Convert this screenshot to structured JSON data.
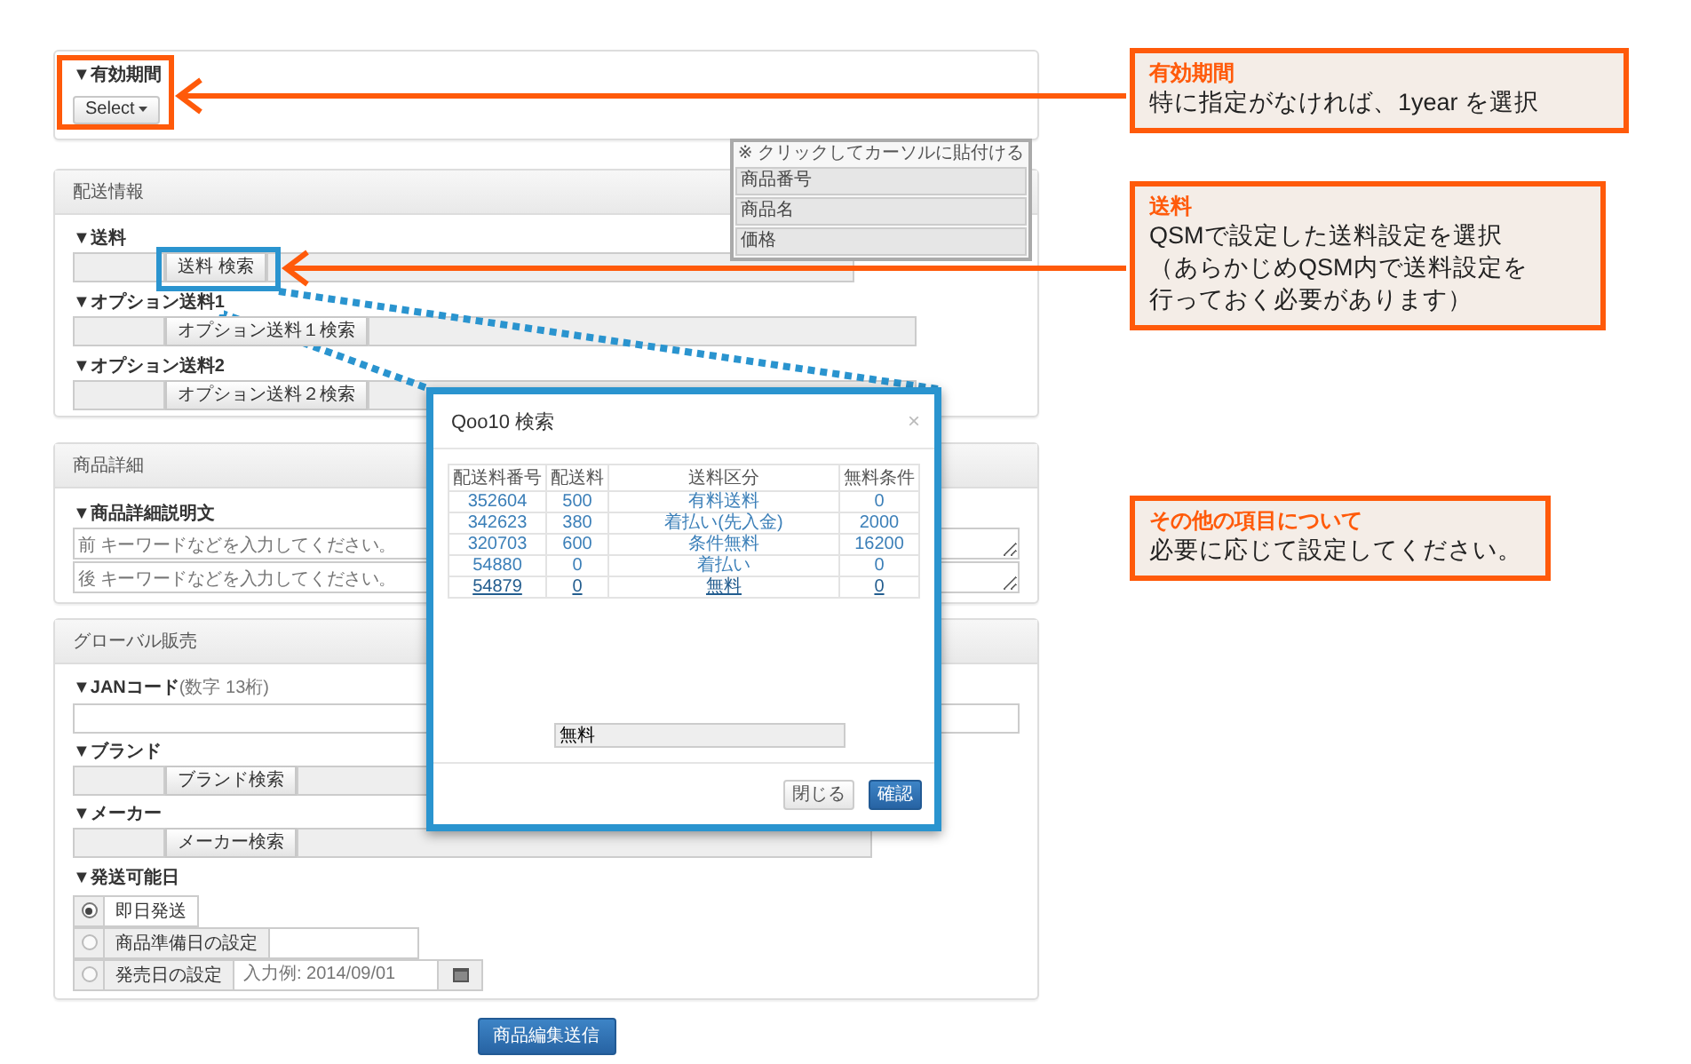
{
  "validity": {
    "label": "▼有効期間",
    "select_button": "Select"
  },
  "shipping": {
    "title": "配送情報",
    "fields": [
      {
        "label": "▼送料",
        "button": "送料 検索"
      },
      {
        "label": "▼オプション送料1",
        "button": "オプション送料１検索"
      },
      {
        "label": "▼オプション送料2",
        "button": "オプション送料２検索"
      }
    ]
  },
  "paste_palette": {
    "note": "※ クリックしてカーソルに貼付ける",
    "items": [
      "商品番号",
      "商品名",
      "価格"
    ]
  },
  "details": {
    "title": "商品詳細",
    "label": "▼商品詳細説明文",
    "textareas": [
      {
        "placeholder": "前 キーワードなどを入力してください。"
      },
      {
        "placeholder": "後 キーワードなどを入力してください。"
      }
    ]
  },
  "global_sales": {
    "title": "グローバル販売",
    "jan": {
      "label": "▼JANコード",
      "hint": "(数字 13桁)"
    },
    "lookups": [
      {
        "label": "▼ブランド",
        "button": "ブランド検索"
      },
      {
        "label": "▼メーカー",
        "button": "メーカー検索"
      }
    ],
    "ship_date": {
      "label": "▼発送可能日",
      "options": [
        {
          "kind": "plain",
          "label": "即日発送",
          "selected": true
        },
        {
          "kind": "input",
          "label": "商品準備日の設定",
          "selected": false
        },
        {
          "kind": "date",
          "label": "発売日の設定",
          "selected": false,
          "placeholder": "入力例: 2014/09/01"
        }
      ]
    }
  },
  "submit_button": "商品編集送信",
  "modal": {
    "title": "Qoo10 検索",
    "close": "×",
    "table": {
      "columns": [
        "配送料番号",
        "配送料",
        "送料区分",
        "無料条件"
      ],
      "rows": [
        {
          "cells": [
            "352604",
            "500",
            "有料送料",
            "0"
          ],
          "hovered": false
        },
        {
          "cells": [
            "342623",
            "380",
            "着払い(先入金)",
            "2000"
          ],
          "hovered": false
        },
        {
          "cells": [
            "320703",
            "600",
            "条件無料",
            "16200"
          ],
          "hovered": false
        },
        {
          "cells": [
            "54880",
            "0",
            "着払い",
            "0"
          ],
          "hovered": false
        },
        {
          "cells": [
            "54879",
            "0",
            "無料",
            "0"
          ],
          "hovered": true
        }
      ]
    },
    "value": "無料",
    "buttons": [
      {
        "kind": "default",
        "label": "閉じる"
      },
      {
        "kind": "primary",
        "label": "確認"
      }
    ]
  },
  "callouts": [
    {
      "title": "有効期間",
      "lines": [
        "特に指定がなければ、1year を選択"
      ]
    },
    {
      "title": "送料",
      "lines": [
        "QSMで設定した送料設定を選択",
        "（あらかじめQSM内で送料設定を",
        "行っておく必要があります）"
      ]
    },
    {
      "title": "その他の項目について",
      "lines": [
        "必要に応じて設定してください。"
      ]
    }
  ]
}
